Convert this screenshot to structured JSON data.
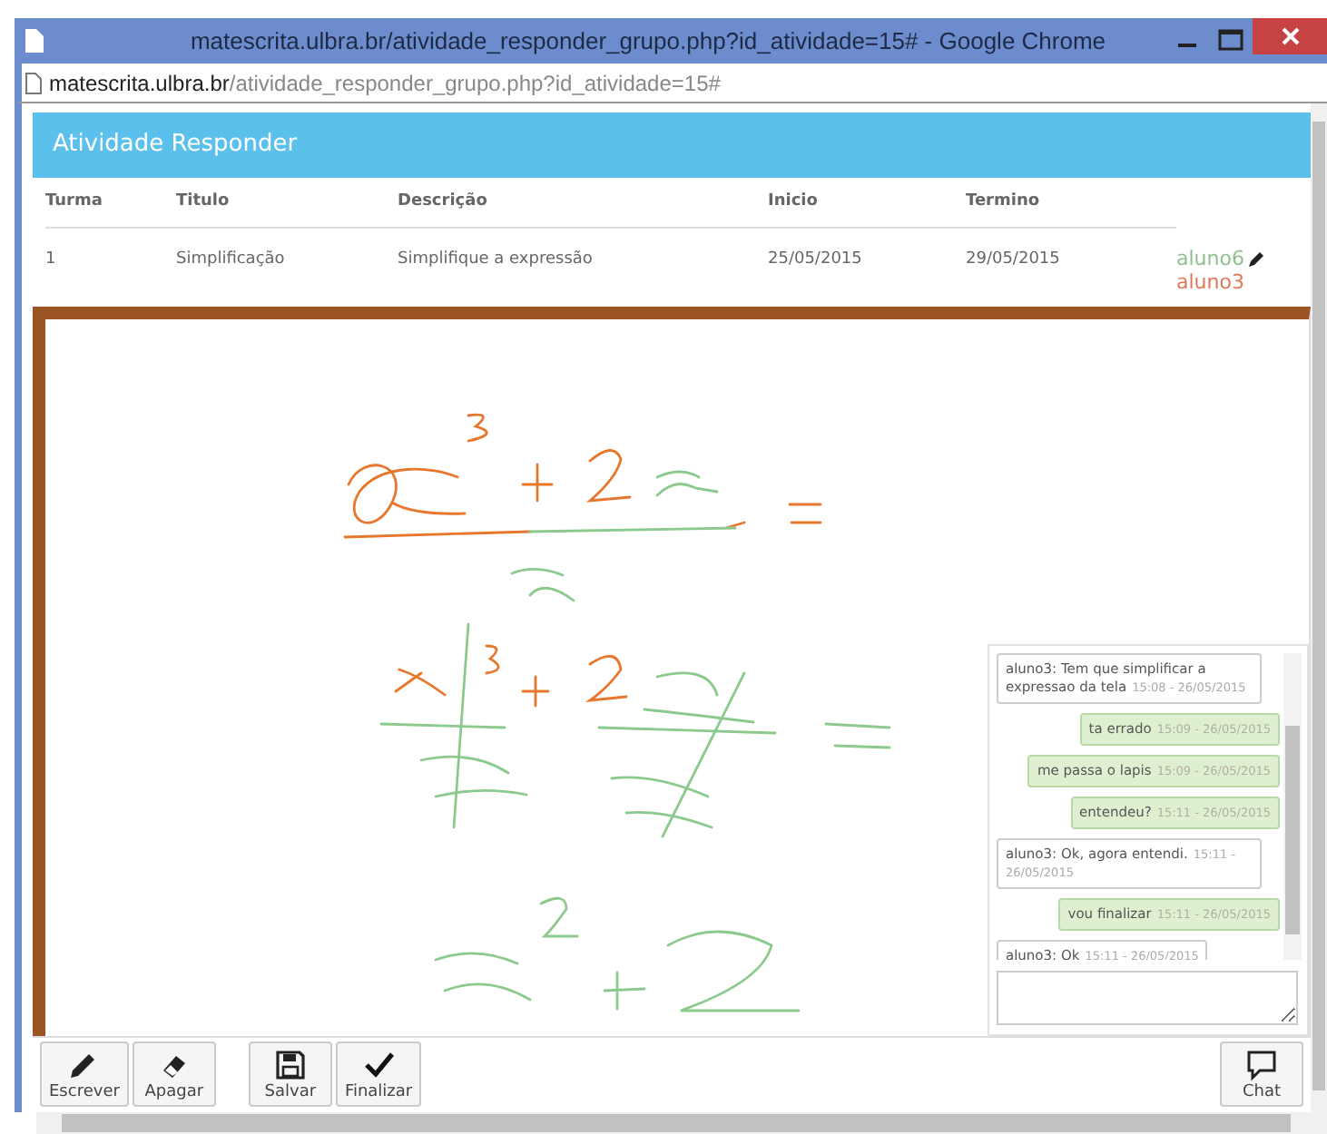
{
  "window": {
    "title": "matescrita.ulbra.br/atividade_responder_grupo.php?id_atividade=15# - Google Chrome"
  },
  "address_bar": {
    "host": "matescrita.ulbra.br",
    "path": "/atividade_responder_grupo.php?id_atividade=15#"
  },
  "panel": {
    "title": "Atividade Responder"
  },
  "table": {
    "columns": [
      "Turma",
      "Titulo",
      "Descrição",
      "Inicio",
      "Termino"
    ],
    "rows": [
      {
        "cells": [
          "1",
          "Simplificação",
          "Simplifique a expressão",
          "25/05/2015",
          "29/05/2015"
        ],
        "members": [
          {
            "name": "aluno6",
            "color": "#8fc08f",
            "has_pencil": true
          },
          {
            "name": "aluno3",
            "color": "#e0785a",
            "has_pencil": false
          }
        ]
      }
    ]
  },
  "chat": {
    "messages": [
      {
        "mine": false,
        "text": "aluno3: Tem que simplificar a expressao da tela",
        "time": "15:08 - 26/05/2015"
      },
      {
        "mine": true,
        "text": "ta errado",
        "time": "15:09 - 26/05/2015"
      },
      {
        "mine": true,
        "text": "me passa o lapis",
        "time": "15:09 - 26/05/2015"
      },
      {
        "mine": true,
        "text": "entendeu?",
        "time": "15:11 - 26/05/2015"
      },
      {
        "mine": false,
        "text": "aluno3: Ok, agora entendi.",
        "time": "15:11 - 26/05/2015"
      },
      {
        "mine": true,
        "text": "vou finalizar",
        "time": "15:11 - 26/05/2015"
      },
      {
        "mine": false,
        "text": "aluno3: Ok",
        "time": "15:11 - 26/05/2015"
      }
    ]
  },
  "toolbar": {
    "groups": [
      [
        {
          "label": "Escrever",
          "kind": "pencil"
        },
        {
          "label": "Apagar",
          "kind": "eraser"
        }
      ],
      [
        {
          "label": "Salvar",
          "kind": "save"
        },
        {
          "label": "Finalizar",
          "kind": "check"
        }
      ]
    ],
    "right": [
      {
        "label": "Chat",
        "kind": "chat"
      }
    ]
  }
}
